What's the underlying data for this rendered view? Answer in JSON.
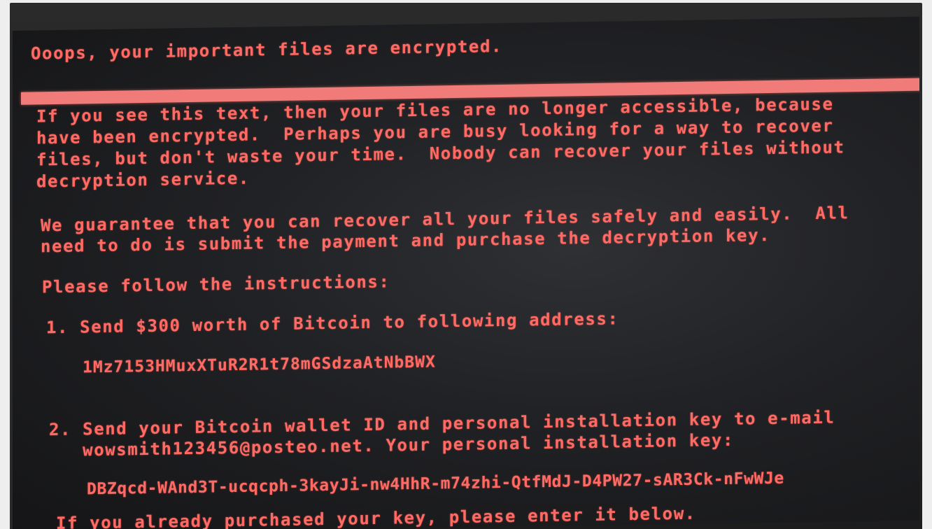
{
  "screen": {
    "title": "Ooops, your important files are encrypted.",
    "paragraph1": [
      "If you see this text, then your files are no longer accessible, because",
      "have been encrypted.  Perhaps you are busy looking for a way to recover",
      "files, but don't waste your time.  Nobody can recover your files without",
      "decryption service."
    ],
    "paragraph2": [
      "We guarantee that you can recover all your files safely and easily.  All",
      "need to do is submit the payment and purchase the decryption key."
    ],
    "instructions_heading": "Please follow the instructions:",
    "step1": "1. Send $300 worth of Bitcoin to following address:",
    "bitcoin_address": "1Mz7153HMuxXTuR2R1t78mGSdzaAtNbBWX",
    "step2": [
      "2. Send your Bitcoin wallet ID and personal installation key to e-mail",
      "   wowsmith123456@posteo.net. Your personal installation key:"
    ],
    "installation_key": "DBZqcd-WAnd3T-ucqcph-3kayJi-nw4HhR-m74zhi-QtfMdJ-D4PW27-sAR3Ck-nFwWJe",
    "last_line": "If you already purchased your key, please enter it below."
  },
  "colors": {
    "text": "#ff6a64",
    "bar": "#f07b78",
    "screen_background": "#202124"
  }
}
